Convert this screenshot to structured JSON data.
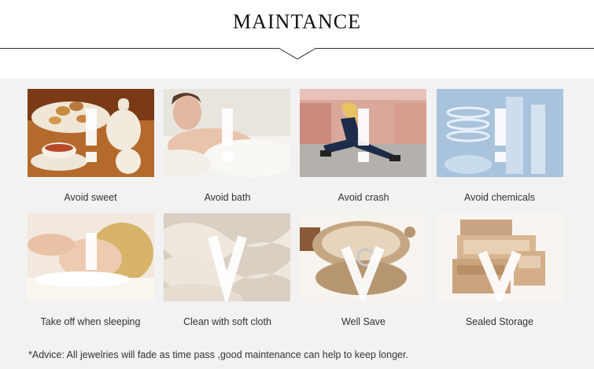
{
  "header": {
    "title": "MAINTANCE"
  },
  "cards": [
    {
      "label": "Avoid sweet",
      "mark": "exclamation",
      "icon": "tea-and-pastries-photo"
    },
    {
      "label": "Avoid bath",
      "mark": "exclamation",
      "icon": "bathing-woman-photo"
    },
    {
      "label": "Avoid crash",
      "mark": "exclamation",
      "icon": "stretching-athlete-photo"
    },
    {
      "label": "Avoid chemicals",
      "mark": "exclamation",
      "icon": "laboratory-glassware-photo"
    },
    {
      "label": "Take off when sleeping",
      "mark": "exclamation",
      "icon": "sleeping-woman-photo"
    },
    {
      "label": "Clean with soft cloth",
      "mark": "check",
      "icon": "silk-cloth-photo"
    },
    {
      "label": "Well Save",
      "mark": "check",
      "icon": "ring-box-photo"
    },
    {
      "label": "Sealed Storage",
      "mark": "check",
      "icon": "jewelry-case-photo"
    }
  ],
  "advice": "*Advice: All jewelries will fade as time pass ,good maintenance can help to keep longer.",
  "colors": {
    "panel": "#f2f2f2",
    "text": "#333333",
    "title": "#111111"
  }
}
